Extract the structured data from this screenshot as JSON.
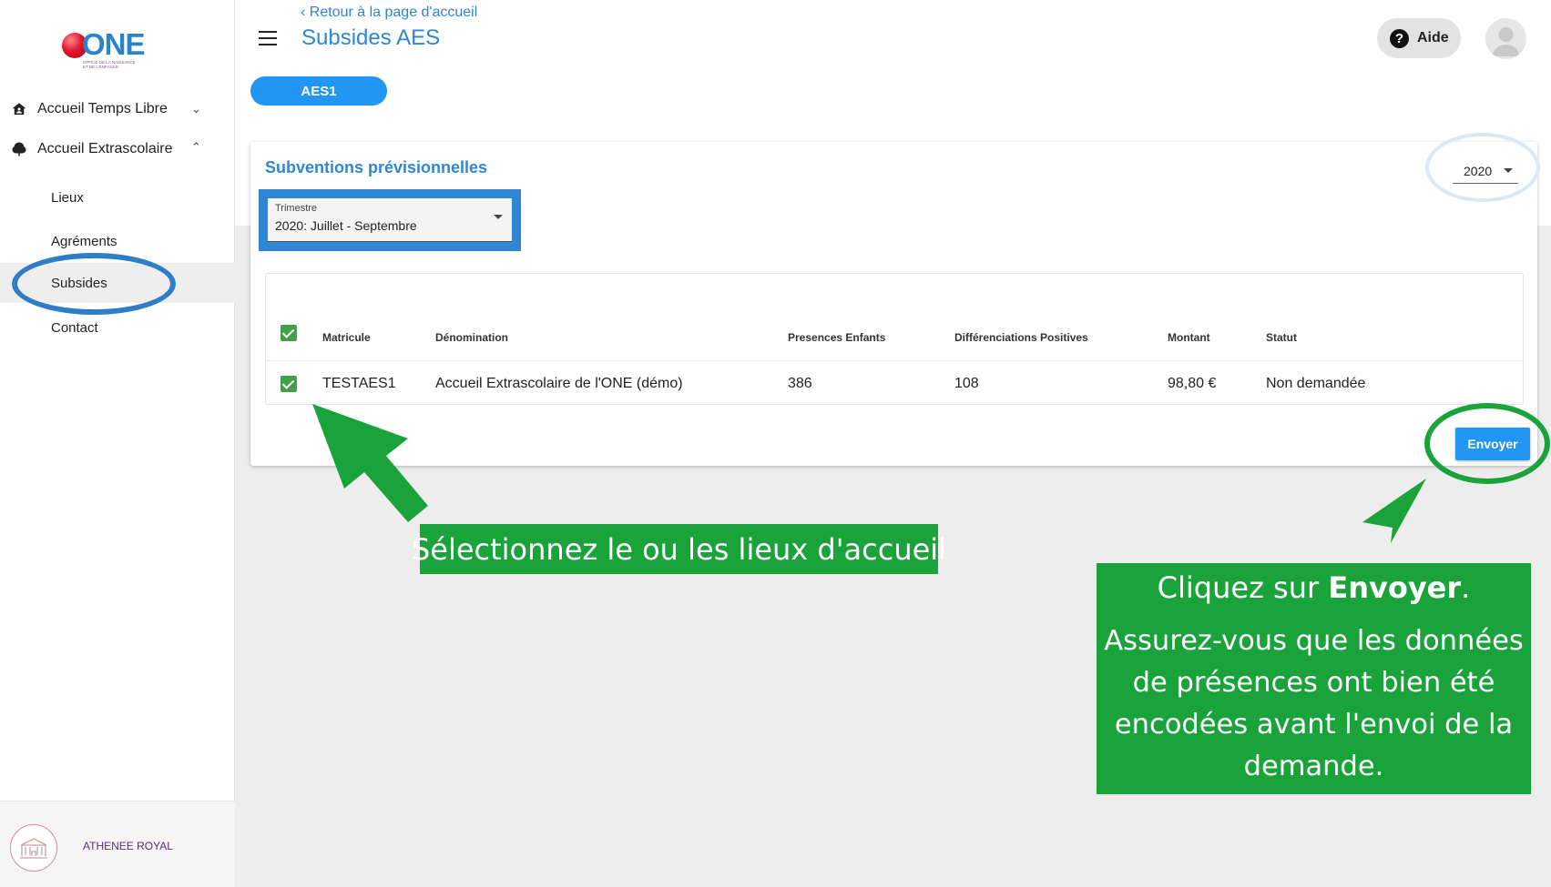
{
  "sidebar": {
    "logo": {
      "text": "ONE",
      "subtitle": "OFFICE DE LA NAISSANCE ET DE L'ENFANCE"
    },
    "items": [
      {
        "label": "Accueil Temps Libre",
        "icon": "house-person-icon",
        "expanded": false
      },
      {
        "label": "Accueil Extrascolaire",
        "icon": "tree-icon",
        "expanded": true
      }
    ],
    "sub_items": [
      {
        "label": "Lieux"
      },
      {
        "label": "Agréments"
      },
      {
        "label": "Subsides",
        "active": true
      },
      {
        "label": "Contact"
      }
    ],
    "footer": {
      "org_name": "ATHENEE ROYAL",
      "icon": "building-icon"
    }
  },
  "header": {
    "back_link": "Retour à la page d'accueil",
    "title": "Subsides AES",
    "help_label": "Aide"
  },
  "tabs": [
    {
      "label": "AES1",
      "active": true
    }
  ],
  "card": {
    "title": "Subventions prévisionnelles",
    "year": "2020",
    "trimester": {
      "label": "Trimestre",
      "value": "2020: Juillet - Septembre"
    },
    "table": {
      "columns": [
        "Matricule",
        "Dénomination",
        "Presences Enfants",
        "Différenciations Positives",
        "Montant",
        "Statut"
      ],
      "rows": [
        {
          "checked": true,
          "matricule": "TESTAES1",
          "denomination": "Accueil Extrascolaire de l'ONE (démo)",
          "presences": "386",
          "differenciations": "108",
          "montant": "98,80 €",
          "statut": "Non demandée"
        }
      ],
      "header_checked": true
    },
    "send_label": "Envoyer"
  },
  "annotations": {
    "callout_select": "Sélectionnez le ou les lieux d'accueil",
    "callout_send_prefix": "Cliquez sur ",
    "callout_send_bold": "Envoyer",
    "callout_send_suffix": ".",
    "callout_send_body": "Assurez-vous que les données de présences ont bien été encodées avant l'envoi de la demande."
  },
  "colors": {
    "primary": "#2196f3",
    "title_blue": "#2f86d2",
    "annotation_green": "#1aa33b",
    "checkbox_green": "#43a047",
    "org_purple": "#5a2d82"
  }
}
